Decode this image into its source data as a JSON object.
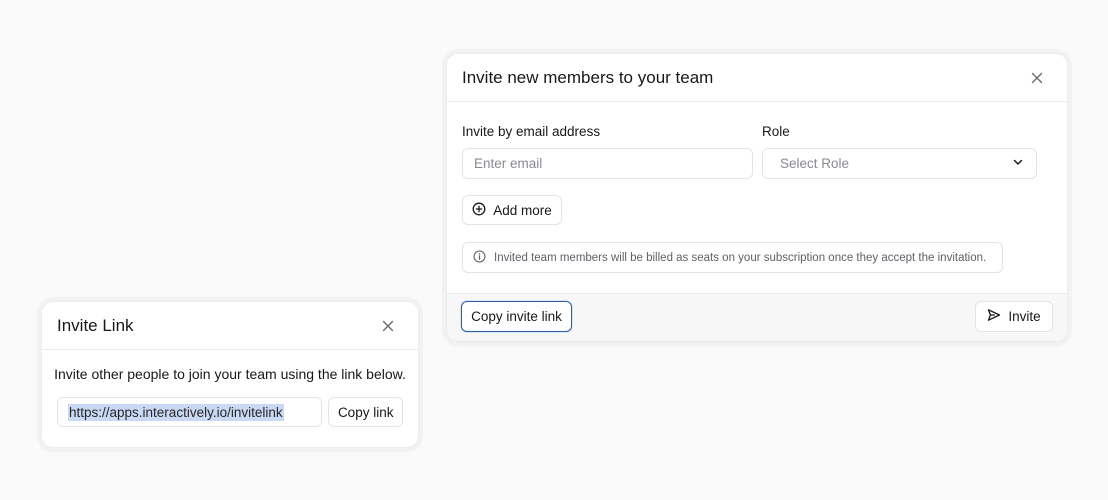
{
  "invite_link_card": {
    "title": "Invite Link",
    "description": "Invite other people to join your team using the link below.",
    "link_value": "https://apps.interactively.io/invitelink",
    "copy_label": "Copy link"
  },
  "team_card": {
    "title": "Invite new members to your team",
    "email_label": "Invite by email address",
    "email_placeholder": "Enter email",
    "role_label": "Role",
    "role_placeholder": "Select Role",
    "add_more_label": "Add more",
    "notice": "Invited team members will be billed as seats on your subscription once they accept the invitation.",
    "copy_invite_label": "Copy invite link",
    "invite_label": "Invite"
  },
  "colors": {
    "focus_border": "#2f5e9e",
    "selection": "#c9d9f3",
    "footer_bg": "#f7f7f8"
  },
  "icons": [
    "close-icon",
    "chevron-down-icon",
    "plus-circle-icon",
    "info-icon",
    "send-icon"
  ]
}
